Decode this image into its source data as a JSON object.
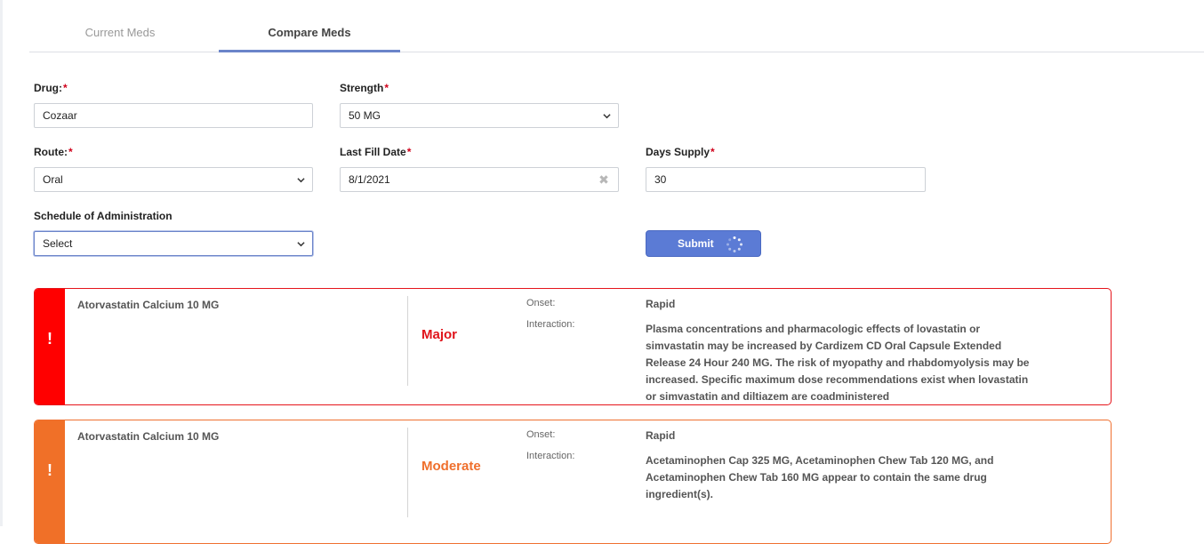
{
  "tabs": [
    {
      "label": "Current Meds",
      "active": false
    },
    {
      "label": "Compare Meds",
      "active": true
    }
  ],
  "form": {
    "drug": {
      "label": "Drug:",
      "required": "*",
      "value": "Cozaar"
    },
    "strength": {
      "label": "Strength",
      "required": "*",
      "value": "50 MG"
    },
    "route": {
      "label": "Route:",
      "required": "*",
      "value": "Oral"
    },
    "last_fill_date": {
      "label": "Last Fill Date",
      "required": "*",
      "value": "8/1/2021"
    },
    "days_supply": {
      "label": "Days Supply",
      "required": "*",
      "value": "30"
    },
    "schedule": {
      "label": "Schedule of Administration",
      "value": "Select"
    },
    "submit_label": "Submit"
  },
  "interactions": [
    {
      "drug": "Atorvastatin Calcium 10 MG",
      "severity": "Major",
      "onset_label": "Onset:",
      "onset": "Rapid",
      "interaction_label": "Interaction:",
      "description": "Plasma concentrations and pharmacologic effects of lovastatin or simvastatin may be increased by Cardizem CD Oral Capsule Extended Release 24 Hour 240 MG. The risk of myopathy and rhabdomyolysis may be increased. Specific maximum dose recommendations exist when lovastatin or simvastatin and diltiazem are coadministered",
      "alert_symbol": "!"
    },
    {
      "drug": "Atorvastatin Calcium 10 MG",
      "severity": "Moderate",
      "onset_label": "Onset:",
      "onset": "Rapid",
      "interaction_label": "Interaction:",
      "description": "Acetaminophen Cap 325 MG, Acetaminophen Chew Tab 120 MG, and Acetaminophen Chew Tab 160 MG appear to contain the same drug ingredient(s).",
      "alert_symbol": "!"
    }
  ],
  "colors": {
    "accent": "#5b7bd5",
    "tab_underline": "#6b84c9",
    "required": "#d0021b",
    "major": "#ff0000",
    "moderate": "#f07028"
  }
}
